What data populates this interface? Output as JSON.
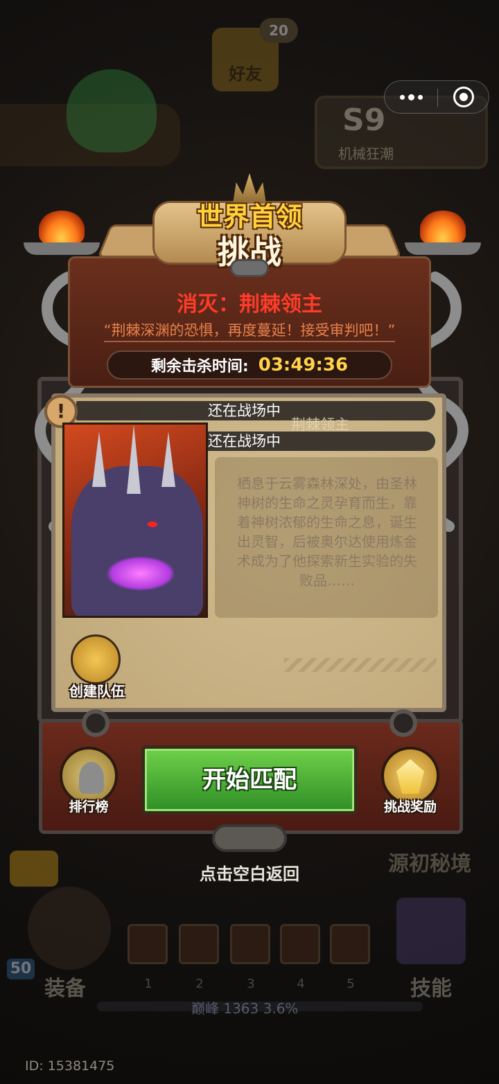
{
  "background": {
    "friends": {
      "label": "好友",
      "badge": "20"
    },
    "season": {
      "code": "S9",
      "name": "机械狂潮"
    },
    "secret_realm": "源初秘境",
    "equipment_label": "装备",
    "skills_label": "技能",
    "level": "50",
    "skill_slots": [
      "1",
      "2",
      "3",
      "4",
      "5"
    ],
    "peak": "巅峰 1363   3.6%",
    "user_id": "ID: 15381475"
  },
  "modal": {
    "title_top": "世界首领",
    "title_main": "挑战",
    "target_label": "消灭：",
    "target_name": "荆棘领主",
    "quote": "“荆棘深渊的恐惧，再度蔓延！接受审判吧！”",
    "timer_label": "剩余击杀时间:",
    "timer_value": "03:49:36",
    "alert_symbol": "!",
    "status_1": "还在战场中",
    "status_2": "还在战场中",
    "boss_name": "荆棘领主",
    "description": "栖息于云雾森林深处，由圣林神树的生命之灵孕育而生，靠着神树浓郁的生命之息，诞生出灵智，后被奥尔达使用炼金术成为了他探索新生实验的失败品……",
    "create_team": "创建队伍",
    "leaderboard": "排行榜",
    "start_match": "开始匹配",
    "challenge_reward": "挑战奖励",
    "back_hint": "点击空白返回"
  },
  "colors": {
    "target_red": "#ff3b2a",
    "timer_gold": "#ffd34a",
    "start_green": "#4caf37",
    "quote_orange": "#e8824a"
  }
}
